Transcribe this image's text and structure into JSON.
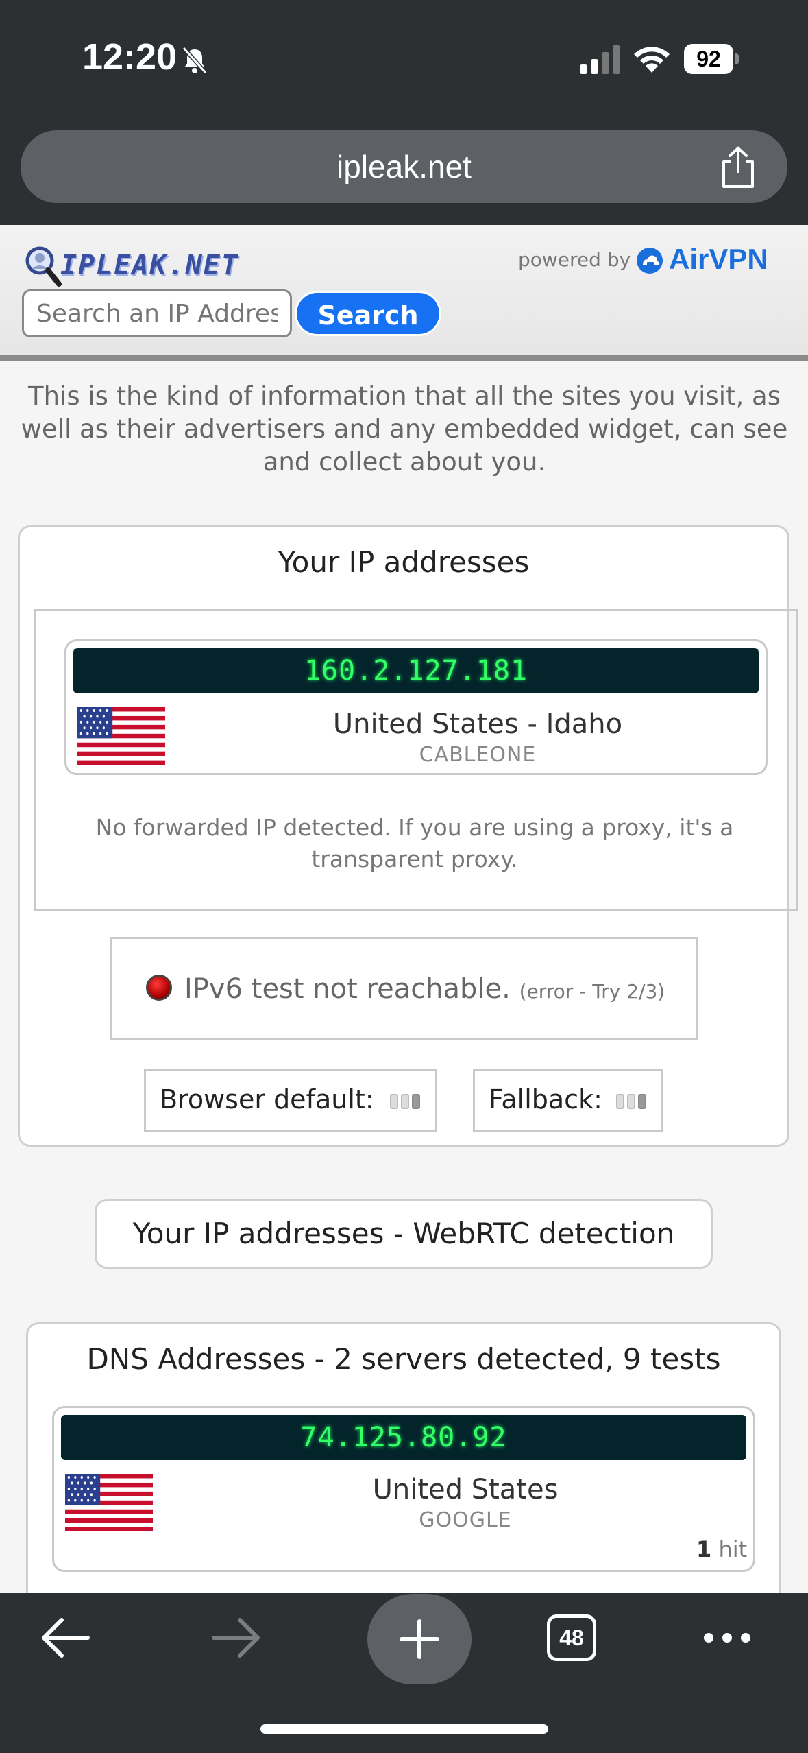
{
  "status_bar": {
    "time": "12:20",
    "battery": "92"
  },
  "browser": {
    "url": "ipleak.net",
    "tab_count": "48"
  },
  "header": {
    "logo_text": "IPLEAK.NET",
    "powered_by": "powered by",
    "sponsor": "AirVPN",
    "search_placeholder": "Search an IP Address",
    "search_button": "Search"
  },
  "intro_text": "This is the kind of information that all the sites you visit, as well as their advertisers and any embedded widget, can see and collect about you.",
  "ip_section": {
    "title": "Your IP addresses",
    "ip": "160.2.127.181",
    "location": "United States - Idaho",
    "isp": "CABLEONE",
    "note": "No forwarded IP detected. If you are using a proxy, it's a transparent proxy.",
    "ipv6_text": "IPv6 test not reachable.",
    "ipv6_sub": "(error - Try 2/3)",
    "browser_default_label": "Browser default:",
    "fallback_label": "Fallback:"
  },
  "webrtc_button": "Your IP addresses - WebRTC detection",
  "dns_section": {
    "title": "DNS Addresses - 2 servers detected, 9 tests",
    "ip": "74.125.80.92",
    "location": "United States",
    "isp": "GOOGLE",
    "hit_count": "1",
    "hit_label": "hit"
  },
  "icons": [
    "bell-off-icon",
    "signal-icon",
    "wifi-icon",
    "battery-icon",
    "share-icon",
    "back-icon",
    "forward-icon",
    "plus-icon",
    "tabs-icon",
    "more-icon",
    "us-flag-icon"
  ]
}
